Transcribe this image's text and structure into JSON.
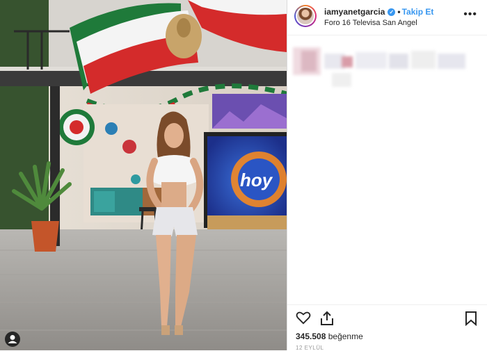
{
  "post": {
    "username": "iamyanetgarcia",
    "follow_label": "Takip Et",
    "location": "Foro 16 Televisa San Angel",
    "verified_glyph": "✓",
    "more_glyph": "•••",
    "likes_count": "345.508",
    "likes_label": "beğenme",
    "date": "12 EYLÜL"
  },
  "photo": {
    "screen_logo": "hoy"
  },
  "icons": {
    "heart": "heart-icon",
    "share": "share-icon",
    "bookmark": "bookmark-icon",
    "user": "user-icon",
    "more": "more-options-icon"
  },
  "colors": {
    "accent": "#3897f0",
    "text": "#262626",
    "flag_green": "#1f7a3a",
    "flag_red": "#d42b2b"
  }
}
